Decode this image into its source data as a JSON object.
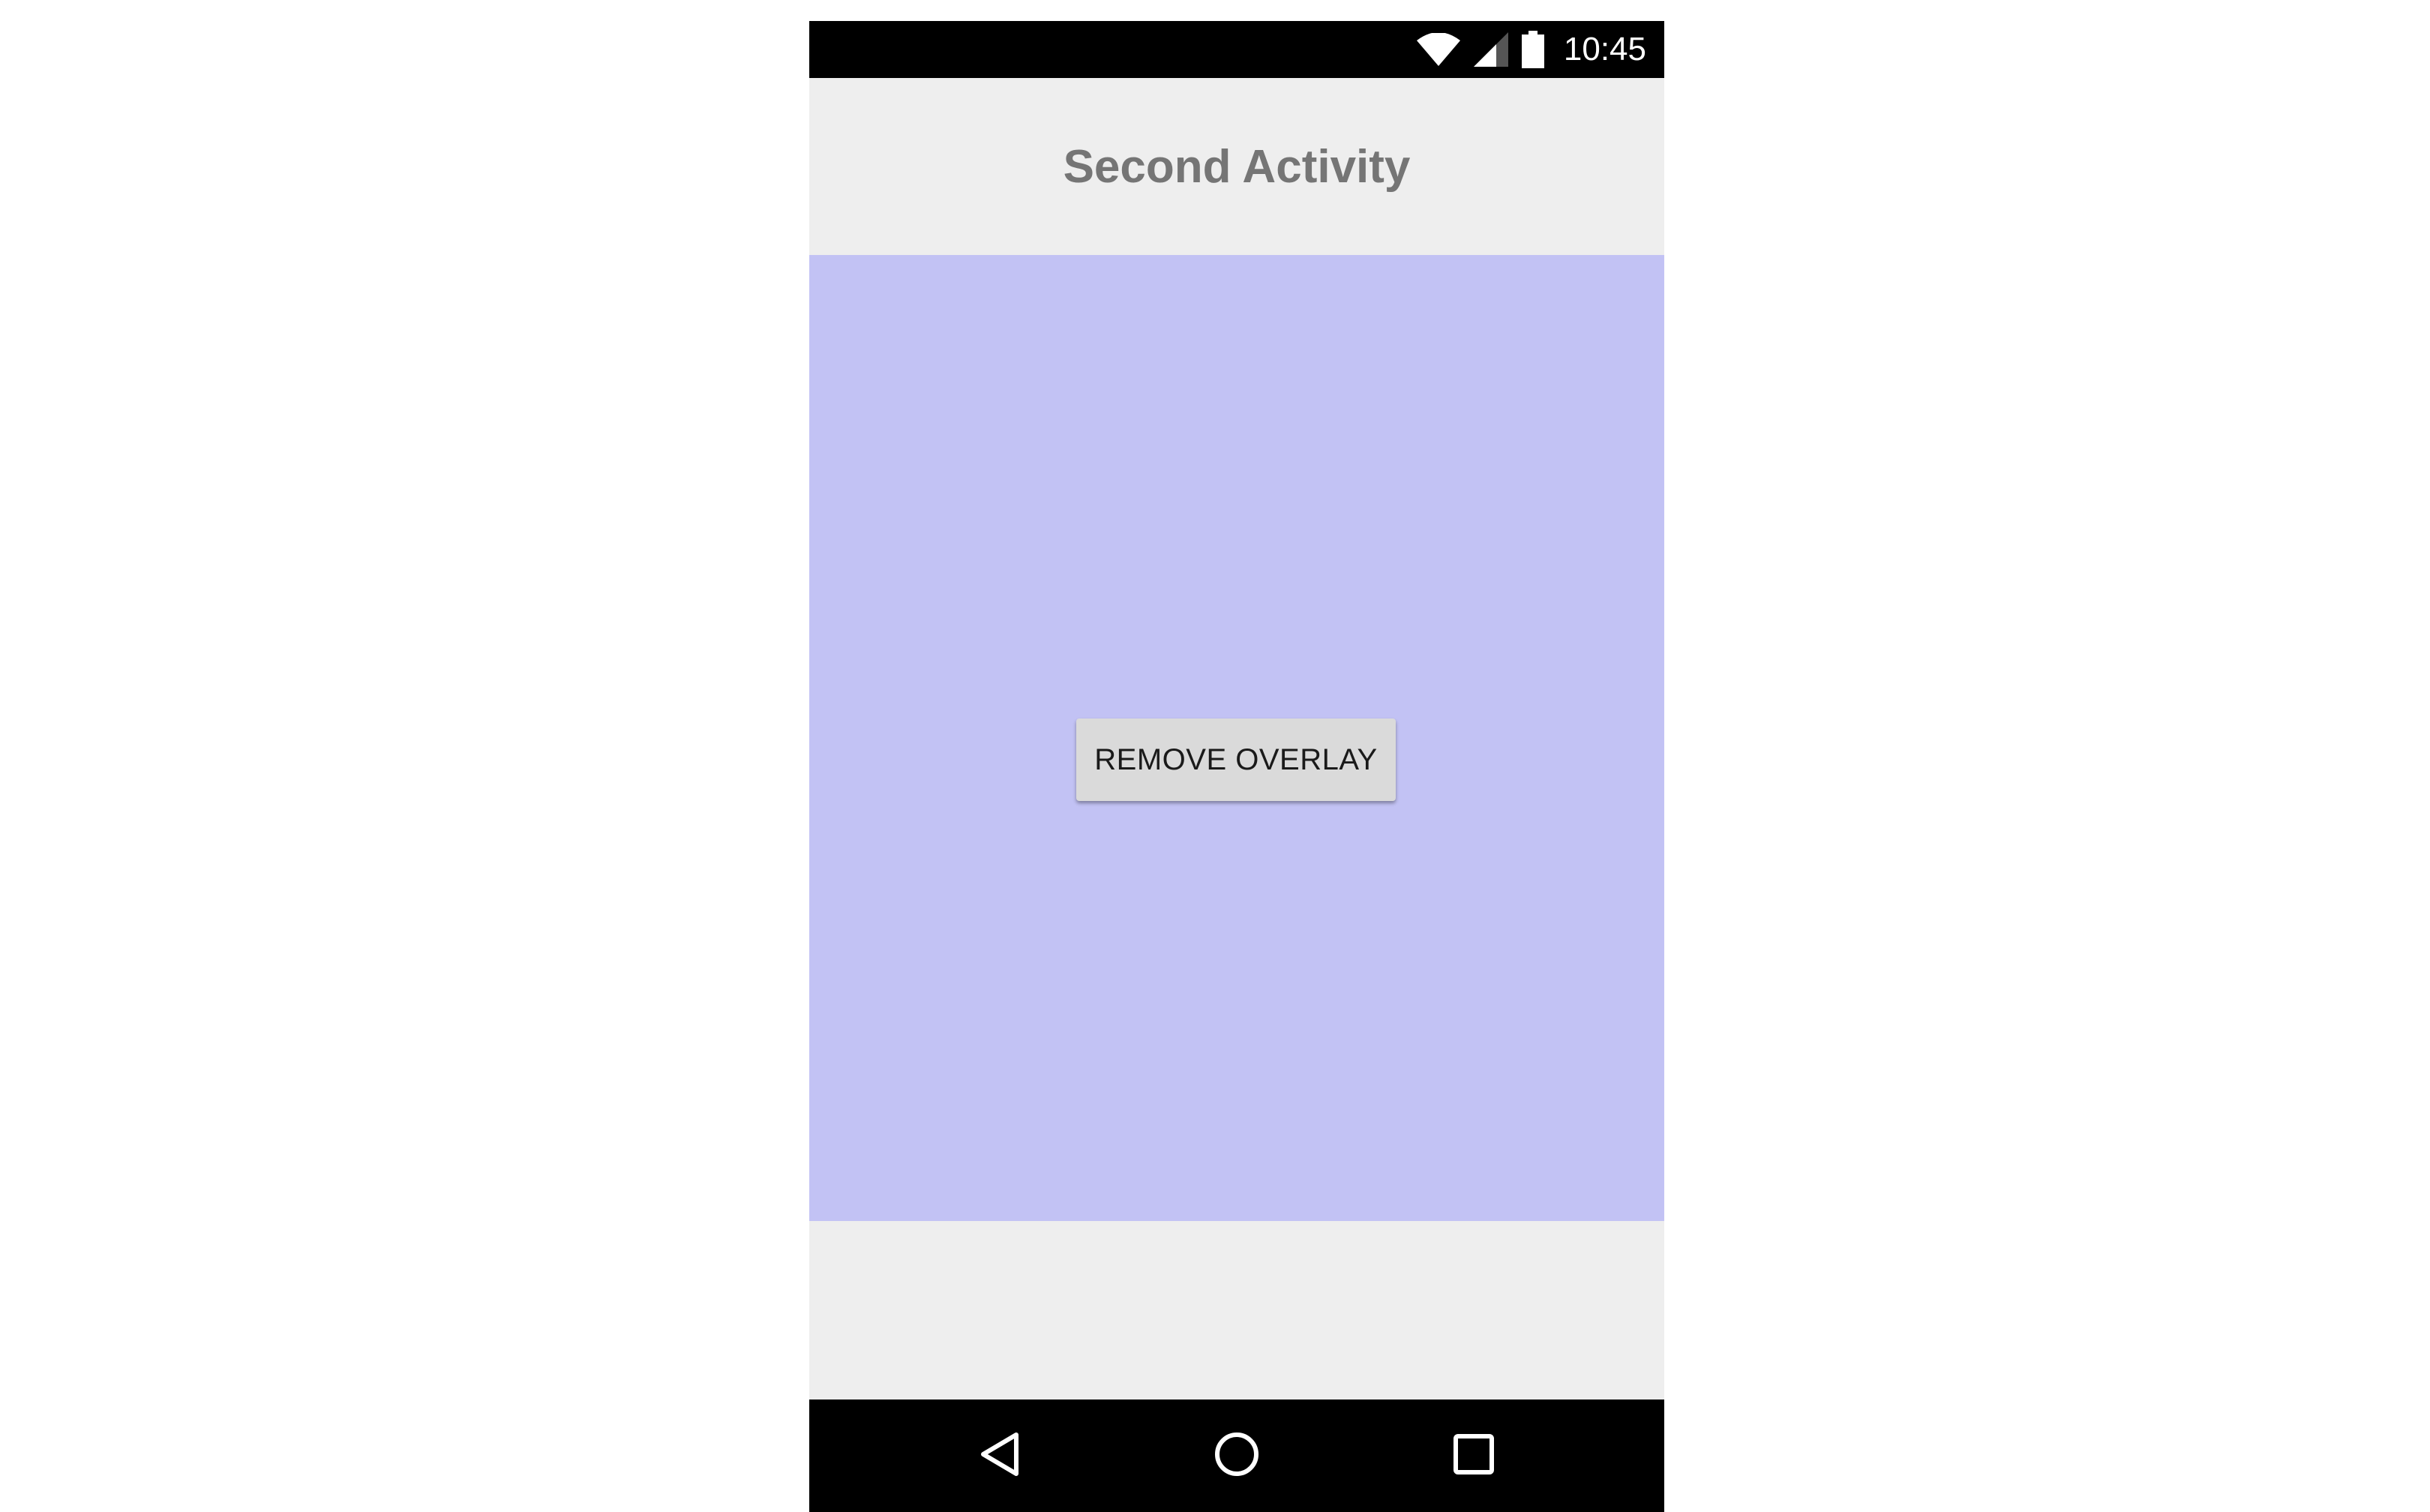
{
  "status_bar": {
    "time": "10:45",
    "icons": [
      "wifi-icon",
      "cell-signal-icon",
      "battery-icon"
    ]
  },
  "app": {
    "title": "Second Activity"
  },
  "overlay": {
    "color": "#c2c2f4",
    "button_label": "REMOVE OVERLAY"
  },
  "nav_bar": {
    "buttons": [
      "back-icon",
      "home-icon",
      "recents-icon"
    ]
  },
  "colors": {
    "background": "#eeeeee",
    "title_text": "#757575",
    "button_bg": "#dadada",
    "system_bars": "#000000"
  }
}
